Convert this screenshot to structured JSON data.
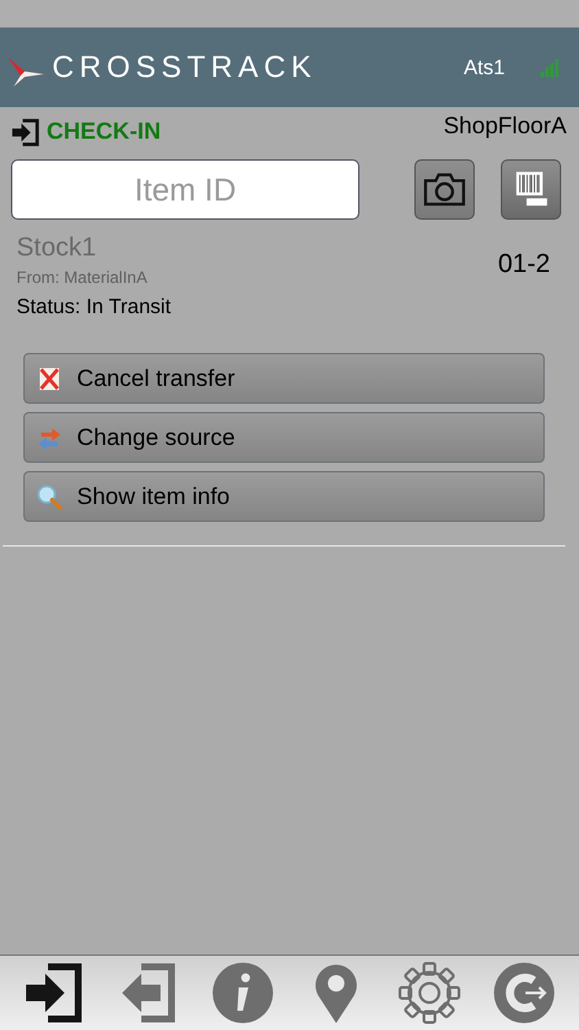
{
  "header": {
    "logo": "CROSSTRACK",
    "user": "Ats1"
  },
  "mode": {
    "label": "CHECK-IN",
    "location": "ShopFloorA"
  },
  "item_field": {
    "placeholder": "Item ID"
  },
  "item": {
    "name": "Stock1",
    "from": "From: MaterialInA",
    "code": "01-2",
    "status": "Status: In Transit"
  },
  "actions": [
    {
      "kind": "cancel",
      "label": "Cancel transfer"
    },
    {
      "kind": "swap",
      "label": "Change source"
    },
    {
      "kind": "search",
      "label": "Show item info"
    }
  ],
  "tabs": [
    {
      "kind": "checkin",
      "selected": true
    },
    {
      "kind": "checkout",
      "selected": false
    },
    {
      "kind": "info",
      "selected": false
    },
    {
      "kind": "location",
      "selected": false
    },
    {
      "kind": "settings",
      "selected": false
    },
    {
      "kind": "logout",
      "selected": false
    }
  ]
}
